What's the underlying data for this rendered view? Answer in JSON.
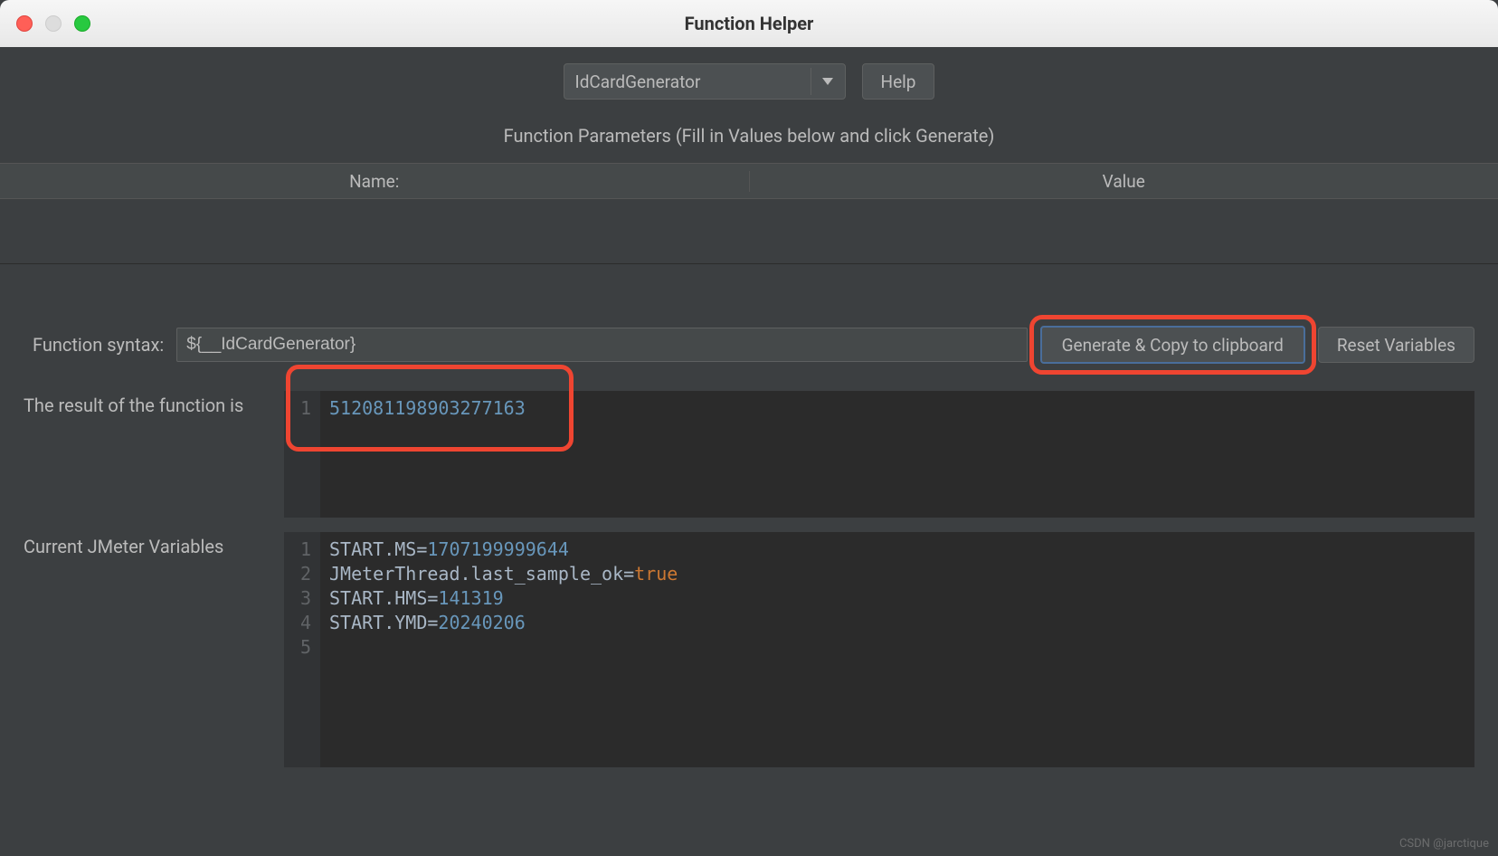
{
  "window": {
    "title": "Function Helper"
  },
  "toolbar": {
    "function_select": "IdCardGenerator",
    "help_label": "Help"
  },
  "params": {
    "section_label": "Function Parameters (Fill in Values below and click Generate)",
    "col_name": "Name:",
    "col_value": "Value"
  },
  "syntax": {
    "label": "Function syntax:",
    "value": "${__IdCardGenerator}",
    "generate_label": "Generate & Copy to clipboard",
    "reset_label": "Reset Variables"
  },
  "result": {
    "label": "The result of the function is",
    "line_no": "1",
    "value": "512081198903277163"
  },
  "vars": {
    "label": "Current JMeter Variables",
    "lines": [
      {
        "n": "1",
        "key": "START.MS",
        "eq": "=",
        "val": "1707199999644",
        "val_class": "num"
      },
      {
        "n": "2",
        "key": "JMeterThread.last_sample_ok",
        "eq": "=",
        "val": "true",
        "val_class": "kw"
      },
      {
        "n": "3",
        "key": "START.HMS",
        "eq": "=",
        "val": "141319",
        "val_class": "num"
      },
      {
        "n": "4",
        "key": "START.YMD",
        "eq": "=",
        "val": "20240206",
        "val_class": "num"
      },
      {
        "n": "5",
        "key": "",
        "eq": "",
        "val": "",
        "val_class": ""
      }
    ]
  },
  "watermark": "CSDN @jarctique"
}
